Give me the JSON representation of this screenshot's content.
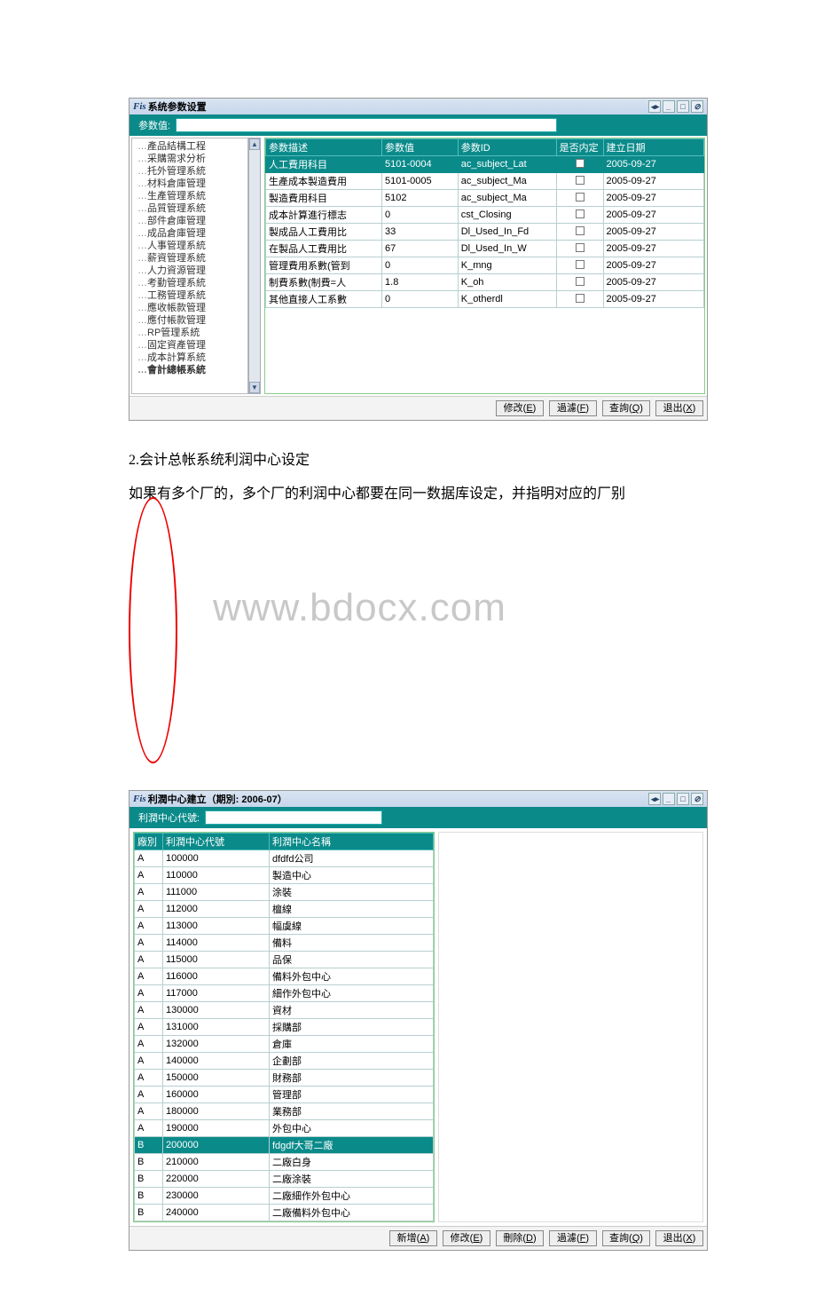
{
  "window1": {
    "title_prefix": "Fis",
    "title": "系统参数设置",
    "search_label": "参数值:",
    "search_value": "",
    "tree": [
      "產品結構工程",
      "采購需求分析",
      "托外管理系統",
      "材料倉庫管理",
      "生產管理系統",
      "品質管理系統",
      "部件倉庫管理",
      "成品倉庫管理",
      "人事管理系統",
      "薪資管理系統",
      "人力資源管理",
      "考勤管理系統",
      "工務管理系統",
      "應收帳款管理",
      "應付帳款管理",
      "RP管理系統",
      "固定資產管理",
      "成本計算系統",
      "會計總帳系統"
    ],
    "tree_bold_index": 18,
    "columns": [
      "参数描述",
      "参数值",
      "参数ID",
      "是否内定",
      "建立日期"
    ],
    "col_widths": [
      "104px",
      "68px",
      "88px",
      "42px",
      "90px"
    ],
    "rows": [
      {
        "desc": "人工費用科目",
        "val": "5101-0004",
        "id": "ac_subject_Lat",
        "chk": false,
        "date": "2005-09-27",
        "hl": true
      },
      {
        "desc": "生產成本製造費用",
        "val": "5101-0005",
        "id": "ac_subject_Ma",
        "chk": false,
        "date": "2005-09-27"
      },
      {
        "desc": "製造費用科目",
        "val": "5102",
        "id": "ac_subject_Ma",
        "chk": false,
        "date": "2005-09-27"
      },
      {
        "desc": "成本計算進行標志",
        "val": "0",
        "id": "cst_Closing",
        "chk": false,
        "date": "2005-09-27"
      },
      {
        "desc": "製成品人工費用比",
        "val": "33",
        "id": "Dl_Used_In_Fd",
        "chk": false,
        "date": "2005-09-27"
      },
      {
        "desc": "在製品人工費用比",
        "val": "67",
        "id": "Dl_Used_In_W",
        "chk": false,
        "date": "2005-09-27"
      },
      {
        "desc": "管理費用系數(管到",
        "val": "0",
        "id": "K_mng",
        "chk": false,
        "date": "2005-09-27"
      },
      {
        "desc": "制費系數(制費=人",
        "val": "1.8",
        "id": "K_oh",
        "chk": false,
        "date": "2005-09-27"
      },
      {
        "desc": "其他直接人工系數",
        "val": "0",
        "id": "K_otherdl",
        "chk": false,
        "date": "2005-09-27"
      }
    ],
    "buttons": [
      {
        "label": "修改",
        "key": "E"
      },
      {
        "label": "過濾",
        "key": "F"
      },
      {
        "label": "查詢",
        "key": "Q"
      },
      {
        "label": "退出",
        "key": "X"
      }
    ]
  },
  "doc": {
    "line1": "2.会计总帐系统利润中心设定",
    "line2": "如果有多个厂的，多个厂的利润中心都要在同一数据库设定，并指明对应的厂别",
    "watermark": "www.bdocx.com"
  },
  "window2": {
    "title_prefix": "Fis",
    "title": "利潤中心建立（期別: 2006-07）",
    "search_label": "利潤中心代號:",
    "search_value": "",
    "columns": [
      "廠別",
      "利潤中心代號",
      "利潤中心名稱"
    ],
    "rows": [
      {
        "f": "A",
        "code": "100000",
        "name": "dfdfd公司"
      },
      {
        "f": "A",
        "code": "110000",
        "name": "製造中心"
      },
      {
        "f": "A",
        "code": "111000",
        "name": "涂裝"
      },
      {
        "f": "A",
        "code": "112000",
        "name": "檀線"
      },
      {
        "f": "A",
        "code": "113000",
        "name": "幅虞線"
      },
      {
        "f": "A",
        "code": "114000",
        "name": "備料"
      },
      {
        "f": "A",
        "code": "115000",
        "name": "品保"
      },
      {
        "f": "A",
        "code": "116000",
        "name": "備料外包中心"
      },
      {
        "f": "A",
        "code": "117000",
        "name": "細作外包中心"
      },
      {
        "f": "A",
        "code": "130000",
        "name": "資材"
      },
      {
        "f": "A",
        "code": "131000",
        "name": "採購部"
      },
      {
        "f": "A",
        "code": "132000",
        "name": "倉庫"
      },
      {
        "f": "A",
        "code": "140000",
        "name": "企劃部"
      },
      {
        "f": "A",
        "code": "150000",
        "name": "財務部"
      },
      {
        "f": "A",
        "code": "160000",
        "name": "管理部"
      },
      {
        "f": "A",
        "code": "180000",
        "name": "業務部"
      },
      {
        "f": "A",
        "code": "190000",
        "name": "外包中心"
      },
      {
        "f": "B",
        "code": "200000",
        "name": "fdgdf大哥二廠",
        "hl": true
      },
      {
        "f": "B",
        "code": "210000",
        "name": "二廠白身"
      },
      {
        "f": "B",
        "code": "220000",
        "name": "二廠涂裝"
      },
      {
        "f": "B",
        "code": "230000",
        "name": "二廠細作外包中心"
      },
      {
        "f": "B",
        "code": "240000",
        "name": "二廠備料外包中心"
      }
    ],
    "buttons": [
      {
        "label": "新增",
        "key": "A"
      },
      {
        "label": "修改",
        "key": "E"
      },
      {
        "label": "刪除",
        "key": "D"
      },
      {
        "label": "過濾",
        "key": "F"
      },
      {
        "label": "查詢",
        "key": "Q"
      },
      {
        "label": "退出",
        "key": "X"
      }
    ]
  }
}
